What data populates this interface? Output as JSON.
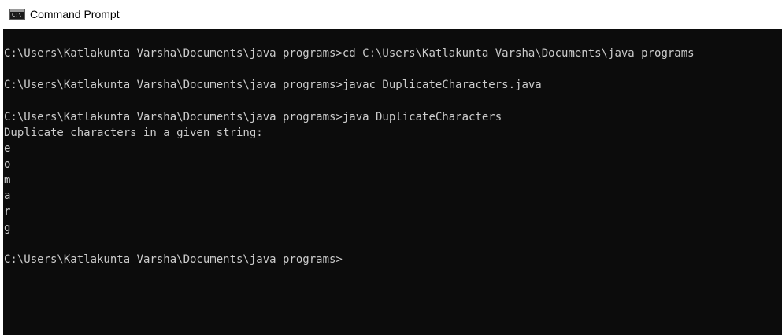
{
  "window": {
    "title": "Command Prompt",
    "icon": "command-prompt-icon"
  },
  "console": {
    "lines": [
      "C:\\Users\\Katlakunta Varsha\\Documents\\java programs>cd C:\\Users\\Katlakunta Varsha\\Documents\\java programs",
      "",
      "C:\\Users\\Katlakunta Varsha\\Documents\\java programs>javac DuplicateCharacters.java",
      "",
      "C:\\Users\\Katlakunta Varsha\\Documents\\java programs>java DuplicateCharacters",
      "Duplicate characters in a given string:",
      "e",
      "o",
      "m",
      "a",
      "r",
      "g",
      "",
      "C:\\Users\\Katlakunta Varsha\\Documents\\java programs>"
    ]
  },
  "colors": {
    "console_background": "#0c0c0c",
    "console_text": "#cccccc",
    "titlebar_background": "#ffffff"
  }
}
